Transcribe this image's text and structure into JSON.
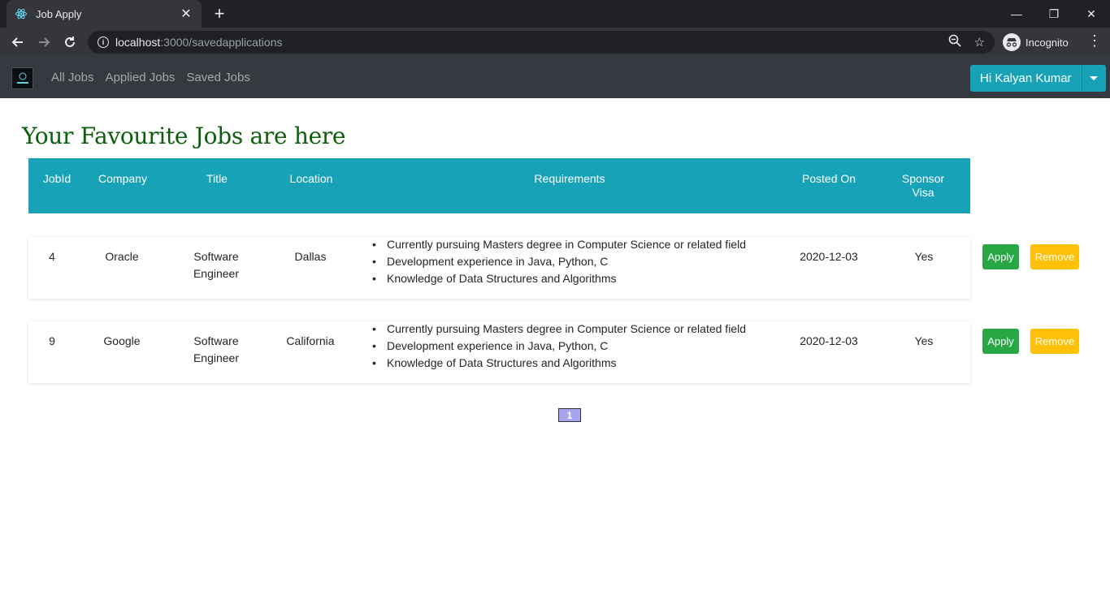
{
  "browser": {
    "tab_title": "Job Apply",
    "url_host": "localhost",
    "url_path": ":3000/savedapplications",
    "profile_label": "Incognito"
  },
  "navbar": {
    "links": [
      "All Jobs",
      "Applied Jobs",
      "Saved Jobs"
    ],
    "user_label": "Hi Kalyan Kumar"
  },
  "page": {
    "title": "Your Favourite Jobs are here"
  },
  "table": {
    "headers": [
      "JobId",
      "Company",
      "Title",
      "Location",
      "Requirements",
      "Posted On",
      "Sponsor Visa"
    ],
    "header_sponsor_line1": "Sponsor",
    "header_sponsor_line2": "Visa",
    "rows": [
      {
        "job_id": "4",
        "company": "Oracle",
        "title_line1": "Software",
        "title_line2": "Engineer",
        "location": "Dallas",
        "requirements": [
          "Currently pursuing Masters degree in Computer Science or related field",
          "Development experience in Java, Python, C",
          "Knowledge of Data Structures and Algorithms"
        ],
        "posted_on": "2020-12-03",
        "sponsor_visa": "Yes",
        "apply_label": "Apply",
        "remove_label": "Remove"
      },
      {
        "job_id": "9",
        "company": "Google",
        "title_line1": "Software",
        "title_line2": "Engineer",
        "location": "California",
        "requirements": [
          "Currently pursuing Masters degree in Computer Science or related field",
          "Development experience in Java, Python, C",
          "Knowledge of Data Structures and Algorithms"
        ],
        "posted_on": "2020-12-03",
        "sponsor_visa": "Yes",
        "apply_label": "Apply",
        "remove_label": "Remove"
      }
    ]
  },
  "pagination": {
    "current_page": "1"
  },
  "colors": {
    "header_bg": "#17a2b8",
    "title_green": "#0b5e0b",
    "apply_green": "#28a745",
    "remove_yellow": "#ffc107"
  }
}
